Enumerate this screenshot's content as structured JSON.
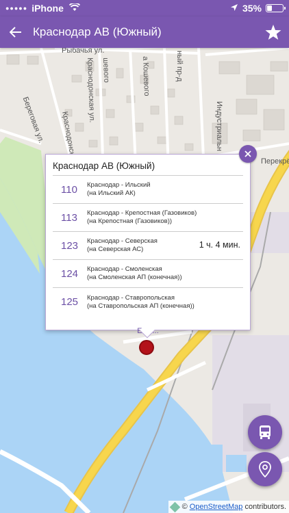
{
  "status_bar": {
    "carrier": "iPhone",
    "battery": "35%",
    "battery_level": 0.35
  },
  "app_bar": {
    "title": "Краснодар АВ (Южный)"
  },
  "map": {
    "streets": {
      "rybachya": "Рыбачья ул.",
      "koshevogo_1": "шевого",
      "koshevogo_2": "а Кошевого",
      "krasnodonskaya_1": "Краснодонская ул.",
      "krasnodonskaya_2": "Краснодонская ул.",
      "industrialny_pr": "ный пр-д",
      "industrialnaya": "Индустриальн",
      "beregovaya": "Береговая ул.",
      "perekrestok": "Перекрё"
    },
    "colors": {
      "land": "#ece9e4",
      "water": "#abd4f6",
      "park": "#cfe9b8",
      "road_major": "#f7d64d",
      "accent": "#7a57b0"
    }
  },
  "popup": {
    "title": "Краснодар АВ (Южный)",
    "routes": [
      {
        "number": "110",
        "name": "Краснодар - Ильский",
        "direction": "(на Ильский АК)",
        "time": ""
      },
      {
        "number": "113",
        "name": "Краснодар - Крепостная (Газовиков)",
        "direction": "(на Крепостная (Газовиков))",
        "time": ""
      },
      {
        "number": "123",
        "name": "Краснодар - Северская",
        "direction": "(на Северская АС)",
        "time": "1 ч. 4 мин."
      },
      {
        "number": "124",
        "name": "Краснодар - Смоленская",
        "direction": "(на Смоленская АП (конечная))",
        "time": ""
      },
      {
        "number": "125",
        "name": "Краснодар - Ставропольская",
        "direction": "(на Ставропольская АП (конечная))",
        "time": ""
      }
    ],
    "more_label": "Еще..."
  },
  "attribution": {
    "prefix": "©",
    "link": "OpenStreetMap",
    "suffix": "contributors."
  },
  "icons": {
    "back": "arrow-left-icon",
    "star": "star-icon",
    "close": "close-icon",
    "bus": "bus-icon",
    "location": "location-pin-icon"
  }
}
